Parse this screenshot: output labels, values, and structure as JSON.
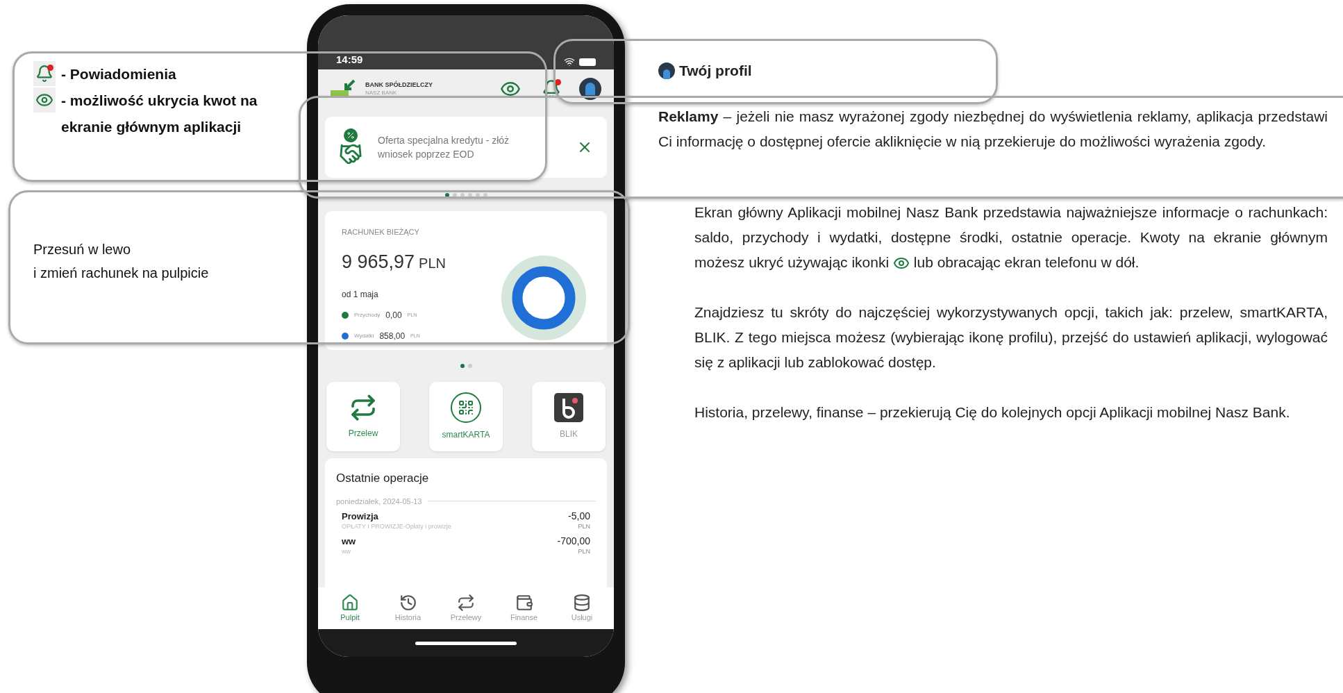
{
  "left_callouts": {
    "legend": [
      {
        "badge": true,
        "text": "-  Powiadomienia"
      },
      {
        "badge": false,
        "text": "- możliwość ukrycia kwot na ekranie głównym aplikacji"
      }
    ],
    "swipe_hint": [
      "Przesuń w lewo",
      "i zmień rachunek na pulpicie"
    ]
  },
  "phone": {
    "status_bar": {
      "time": "14:59"
    },
    "header": {
      "bank_name": "BANK SPÓŁDZIELCZY",
      "bank_subname": "NASZ BANK",
      "notification_badge": true
    },
    "ad": {
      "text": "Oferta specjalna kredytu - złóż wniosek poprzez EOD"
    },
    "ad_pager": [
      {
        "selected": true
      },
      {
        "selected": false
      },
      {
        "selected": false
      },
      {
        "selected": false
      },
      {
        "selected": false
      },
      {
        "selected": false
      }
    ],
    "account": {
      "label": "RACHUNEK BIEŻĄCY",
      "balance": "9 965,97",
      "currency": "PLN",
      "period": "od 1 maja",
      "legend": [
        {
          "label": "Przychody",
          "amount": "0,00",
          "currency": "PLN",
          "color": "#1f7a3f"
        },
        {
          "label": "Wydatki",
          "amount": "858,00",
          "currency": "PLN",
          "color": "#1f6fd6"
        }
      ]
    },
    "account_pager": [
      {
        "selected": true
      },
      {
        "selected": false
      }
    ],
    "shortcuts": [
      {
        "kind": "transfer",
        "label": "Przelew"
      },
      {
        "kind": "qr",
        "label": "smartKARTA"
      },
      {
        "kind": "blik",
        "label": "BLIK"
      }
    ],
    "recent": {
      "title": "Ostatnie operacje",
      "date": "poniedziałek, 2024-05-13",
      "items": [
        {
          "title": "Prowizja",
          "subtitle": "OPŁATY I PROWIZJE-Opłaty i prowizje",
          "amount": "-5,00",
          "currency": "PLN"
        },
        {
          "title": "ww",
          "subtitle": "ww",
          "amount": "-700,00",
          "currency": "PLN"
        }
      ]
    },
    "nav": [
      {
        "label": "Pulpit",
        "selected": true
      },
      {
        "label": "Historia",
        "selected": false
      },
      {
        "label": "Przelewy",
        "selected": false
      },
      {
        "label": "Finanse",
        "selected": false
      },
      {
        "label": "Usługi",
        "selected": false
      }
    ]
  },
  "right": {
    "profile": "Twój profil",
    "ads": "**Reklamy** – jeżeli nie masz wyrażonej zgody niezbędnej do wyświetlenia reklamy, aplikacja przedstawi Ci informację o dostępnej ofercie akliknięcie w nią przekieruje do możliwości wyrażenia zgody.",
    "paragraphs": [
      {
        "before_icon": "Ekran główny Aplikacji mobilnej Nasz Bank przedstawia najważniejsze informacje o rachunkach: saldo, przychody i wydatki, dostępne środki, ostatnie operacje. Kwoty na ekranie głównym możesz ukryć używając ikonki",
        "after_icon": "lub obracając ekran telefonu w dół."
      },
      {
        "before_icon": "Znajdziesz tu skróty do najczęściej wykorzystywanych opcji, takich jak: przelew, smartKARTA, BLIK. Z tego miejsca możesz (wybierając ikonę profilu), przejść do ustawień aplikacji, wylogować się z aplikacji lub zablokować dostęp."
      },
      {
        "before_icon": "Historia, przelewy, finanse – przekierują Cię do kolejnych opcji Aplikacji mobilnej Nasz Bank."
      }
    ]
  }
}
